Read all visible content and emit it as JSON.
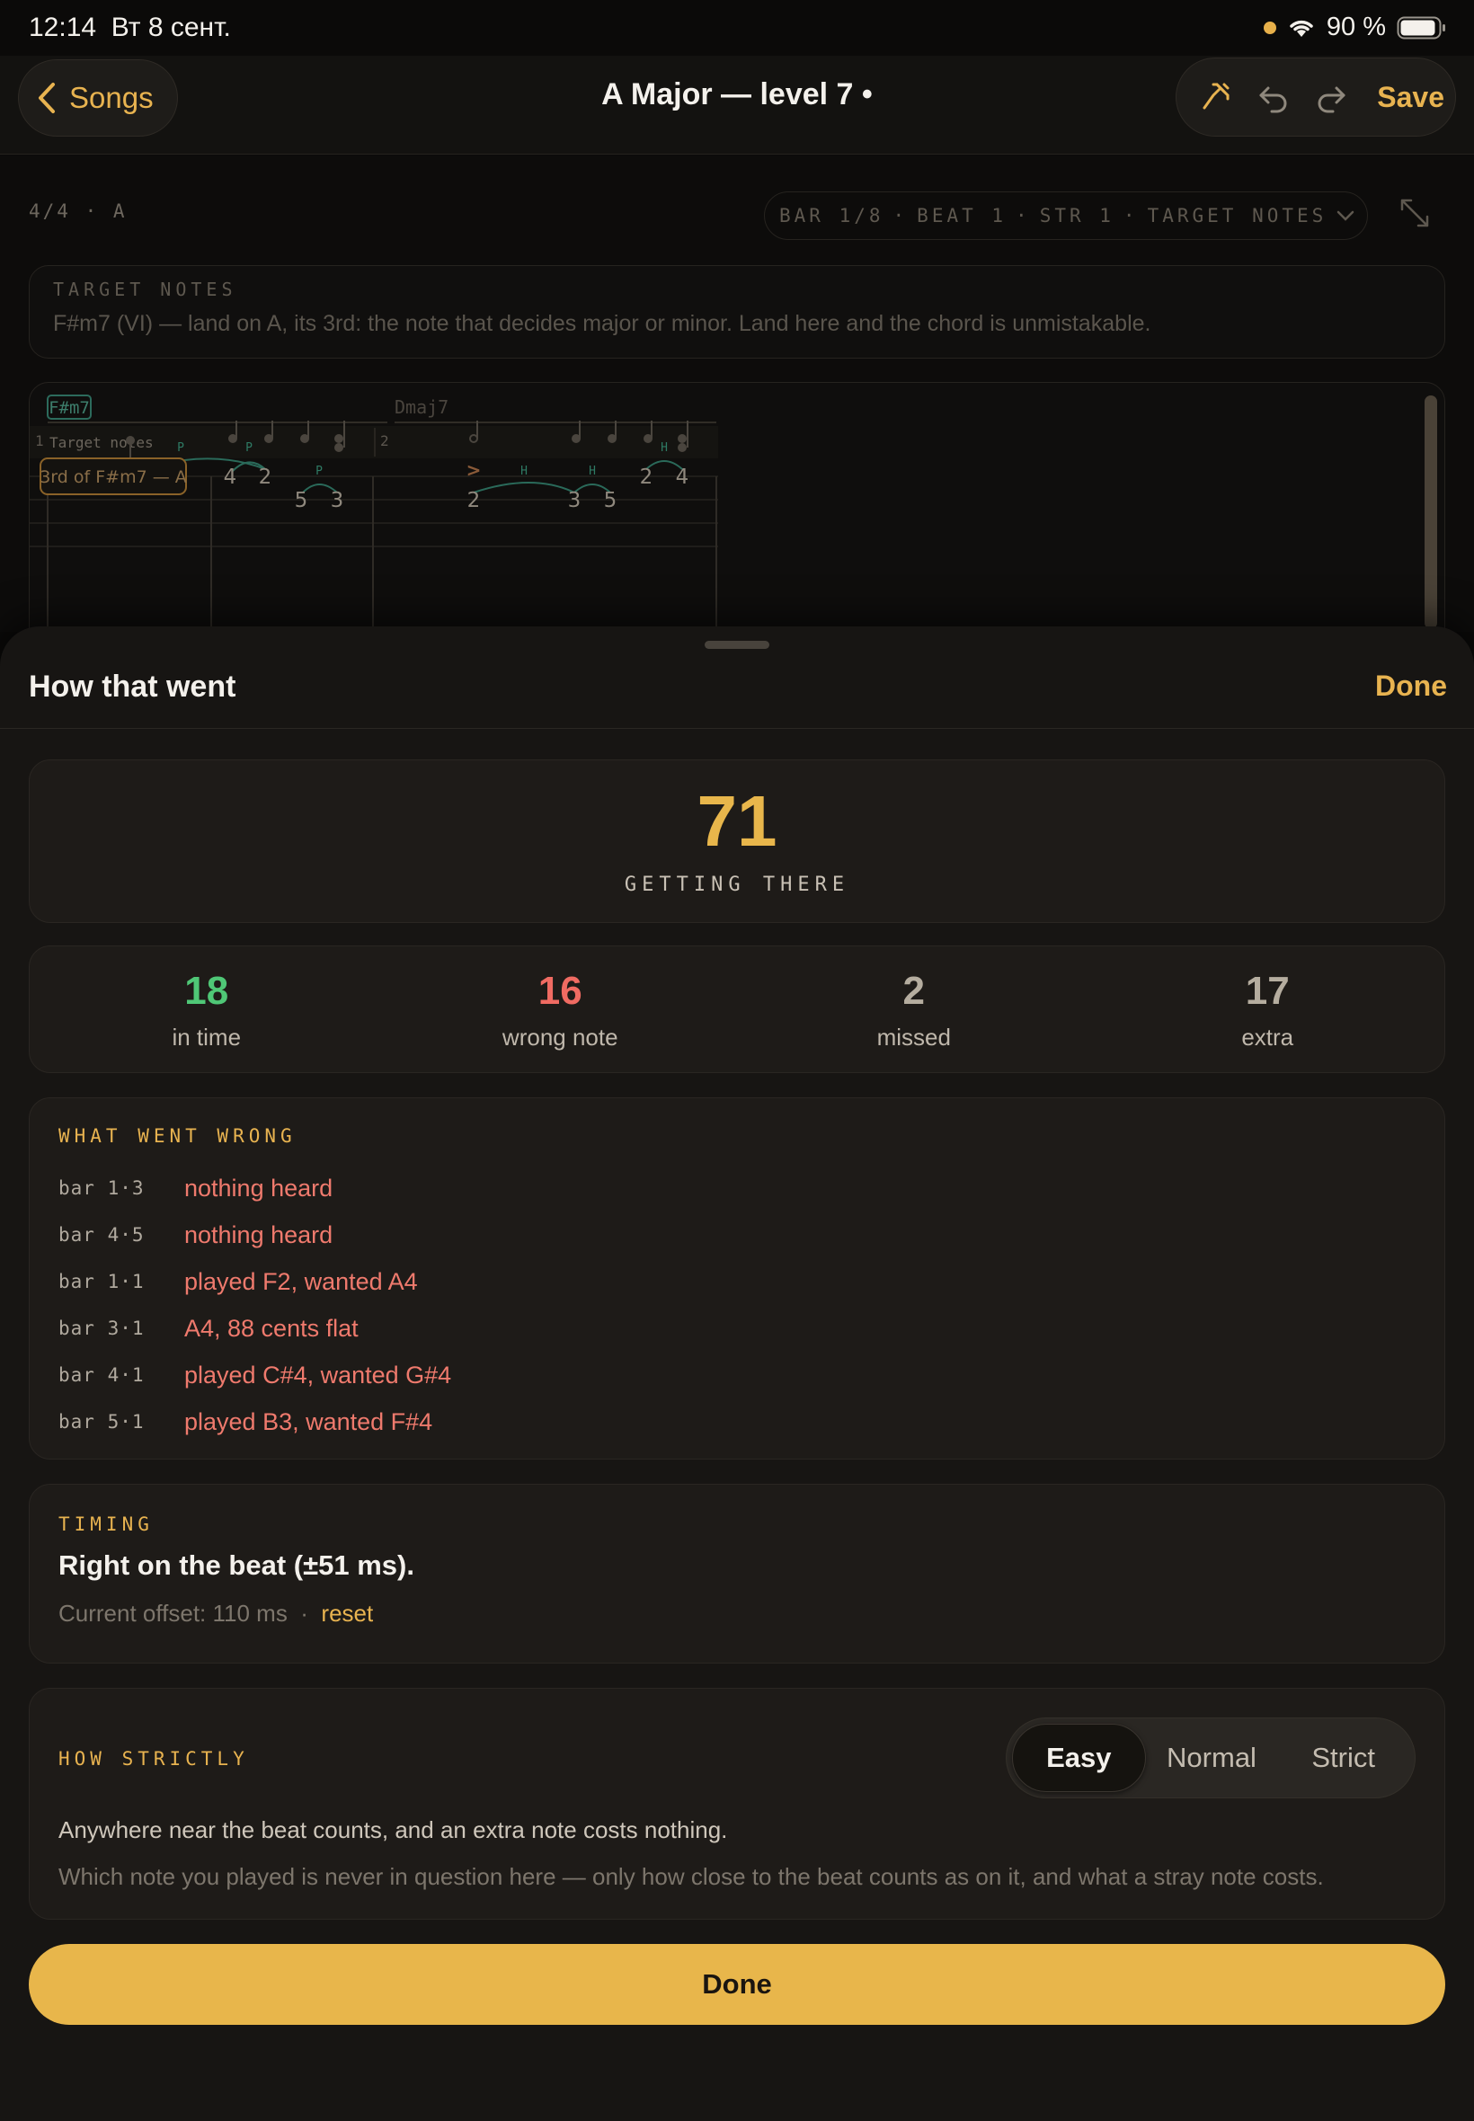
{
  "status": {
    "time": "12:14",
    "date": "Вт 8 сент.",
    "battery": "90 %"
  },
  "nav": {
    "back_label": "Songs",
    "title": "A Major — level 7 •",
    "save_label": "Save"
  },
  "editor": {
    "meta": "4/4 · A",
    "position": {
      "bar": "BAR 1/8",
      "beat": "BEAT 1",
      "str": "STR 1",
      "mode": "TARGET NOTES"
    },
    "target_box": {
      "label": "TARGET NOTES",
      "text": "F#m7 (VI) — land on A, its 3rd: the note that decides major or minor. Land here and the chord is unmistakable."
    },
    "tab": {
      "chord1": "F#m7",
      "chord2": "Dmaj7",
      "bar1_num": "1",
      "bar1_title": "Target notes",
      "bar2_num": "2",
      "callout": "3rd of F#m7 — A",
      "fret_upper": [
        "4",
        "2",
        "2",
        "4"
      ],
      "fret_lower": [
        "5",
        "3",
        "2",
        "3",
        "5"
      ],
      "techniques": [
        "P",
        "P",
        "P",
        "H",
        "H",
        "H"
      ],
      "accent": ">"
    }
  },
  "sheet": {
    "title": "How that went",
    "done_label": "Done",
    "score": {
      "value": "71",
      "label": "GETTING THERE"
    },
    "stats": [
      {
        "value": "18",
        "label": "in time",
        "color": "#4fc776"
      },
      {
        "value": "16",
        "label": "wrong note",
        "color": "#f06b62"
      },
      {
        "value": "2",
        "label": "missed",
        "color": "#b5ad9f"
      },
      {
        "value": "17",
        "label": "extra",
        "color": "#b5ad9f"
      }
    ],
    "wrong": {
      "label": "WHAT WENT WRONG",
      "items": [
        {
          "bar": "bar 1·3",
          "desc": "nothing heard"
        },
        {
          "bar": "bar 4·5",
          "desc": "nothing heard"
        },
        {
          "bar": "bar 1·1",
          "desc": "played F2, wanted A4"
        },
        {
          "bar": "bar 3·1",
          "desc": "A4, 88 cents flat"
        },
        {
          "bar": "bar 4·1",
          "desc": "played C#4, wanted G#4"
        },
        {
          "bar": "bar 5·1",
          "desc": "played B3, wanted F#4"
        }
      ]
    },
    "timing": {
      "label": "TIMING",
      "main": "Right on the beat (±51 ms).",
      "offset": "Current offset: 110 ms",
      "separator": "·",
      "reset_label": "reset"
    },
    "strictness": {
      "label": "HOW STRICTLY",
      "options": [
        "Easy",
        "Normal",
        "Strict"
      ],
      "selected": "Easy",
      "description": "Anywhere near the beat counts, and an extra note costs nothing.",
      "note": "Which note you played is never in question here — only how close to the beat counts as on it, and what a stray note costs."
    },
    "primary_button": "Done"
  }
}
